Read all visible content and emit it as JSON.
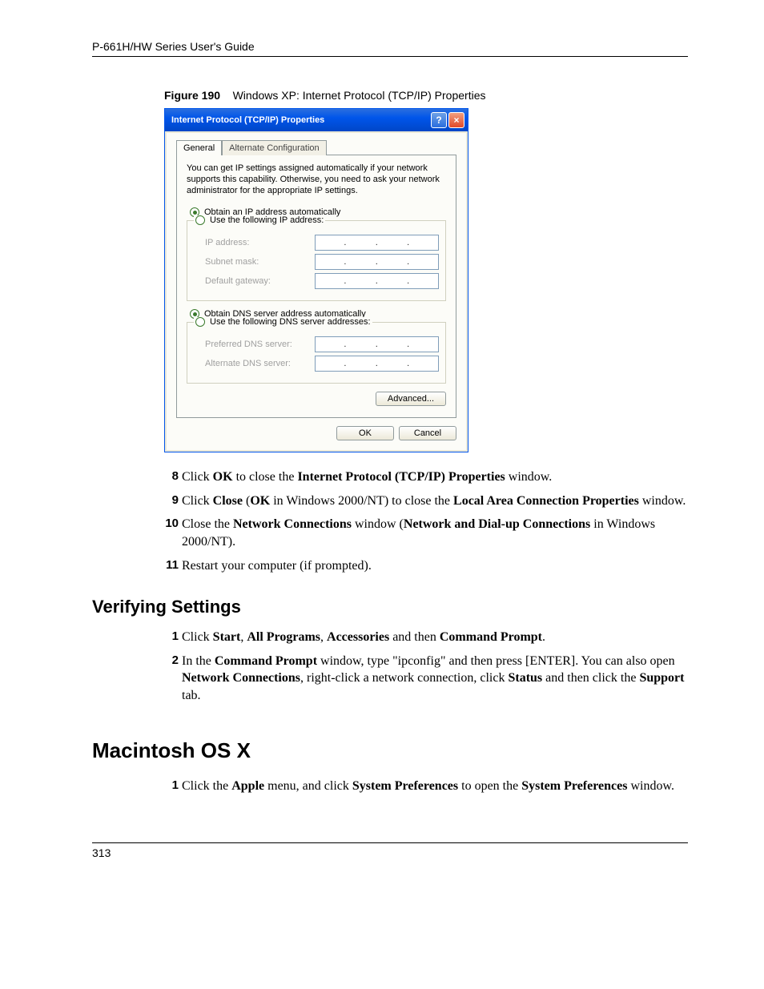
{
  "header": {
    "title": "P-661H/HW Series User's Guide"
  },
  "figure": {
    "label": "Figure 190",
    "caption": "Windows XP: Internet Protocol (TCP/IP) Properties"
  },
  "dialog": {
    "title": "Internet Protocol (TCP/IP) Properties",
    "tabs": {
      "general": "General",
      "alternate": "Alternate Configuration"
    },
    "intro": "You can get IP settings assigned automatically if your network supports this capability. Otherwise, you need to ask your network administrator for the appropriate IP settings.",
    "ip_auto": "Obtain an IP address automatically",
    "ip_manual": "Use the following IP address:",
    "ip_address_label": "IP address:",
    "subnet_label": "Subnet mask:",
    "gateway_label": "Default gateway:",
    "dns_auto": "Obtain DNS server address automatically",
    "dns_manual": "Use the following DNS server addresses:",
    "preferred_dns_label": "Preferred DNS server:",
    "alternate_dns_label": "Alternate DNS server:",
    "advanced": "Advanced...",
    "ok": "OK",
    "cancel": "Cancel"
  },
  "steps_a": {
    "s8": {
      "n": "8",
      "pre": "Click ",
      "b1": "OK",
      "mid1": " to close the ",
      "b2": "Internet Protocol (TCP/IP) Properties",
      "post": " window."
    },
    "s9": {
      "n": "9",
      "pre": "Click ",
      "b1": "Close",
      "mid1": " (",
      "b2": "OK",
      "mid2": " in Windows 2000/NT) to close the ",
      "b3": "Local Area Connection Properties",
      "post": " window."
    },
    "s10": {
      "n": "10",
      "pre": "Close the ",
      "b1": "Network Connections",
      "mid1": " window (",
      "b2": "Network and Dial-up Connections",
      "post": " in Windows 2000/NT)."
    },
    "s11": {
      "n": "11",
      "text": "Restart your computer (if prompted)."
    }
  },
  "h2_verify": "Verifying Settings",
  "steps_b": {
    "s1": {
      "n": "1",
      "pre": "Click ",
      "b1": "Start",
      "c1": ", ",
      "b2": "All Programs",
      "c2": ", ",
      "b3": "Accessories",
      "mid": " and then ",
      "b4": "Command Prompt",
      "post": "."
    },
    "s2": {
      "n": "2",
      "pre": "In the ",
      "b1": "Command Prompt",
      "mid1": " window, type \"ipconfig\" and then press [ENTER]. You can also open ",
      "b2": "Network Connections",
      "mid2": ", right-click a network connection, click ",
      "b3": "Status",
      "mid3": " and then click the ",
      "b4": "Support",
      "post": " tab."
    }
  },
  "h1_mac": "Macintosh OS X",
  "steps_c": {
    "s1": {
      "n": "1",
      "pre": "Click the ",
      "b1": "Apple",
      "mid1": " menu, and click ",
      "b2": "System Preferences",
      "mid2": " to open the ",
      "b3": "System Preferences",
      "post": " window."
    }
  },
  "footer": {
    "page": "313"
  }
}
